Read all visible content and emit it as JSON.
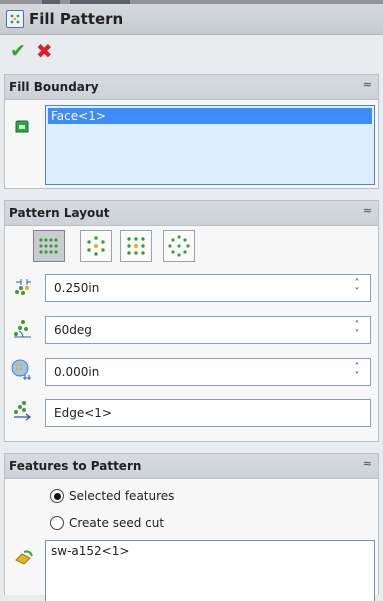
{
  "window": {
    "title": "Fill Pattern"
  },
  "actions": {
    "ok_icon": "checkmark-icon",
    "cancel_icon": "x-icon"
  },
  "fill_boundary": {
    "header": "Fill Boundary",
    "items": [
      "Face<1>"
    ]
  },
  "pattern_layout": {
    "header": "Pattern Layout",
    "layouts": [
      "perforation",
      "circular",
      "square",
      "polygon"
    ],
    "active_layout": "perforation",
    "instance_spacing": "0.250in",
    "stagger_angle": "60deg",
    "margins": "0.000in",
    "pattern_direction": "Edge<1>"
  },
  "features_to_pattern": {
    "header": "Features to Pattern",
    "options": [
      "Selected features",
      "Create seed cut"
    ],
    "selected_option": "Selected features",
    "features": [
      "sw-a152<1>"
    ]
  },
  "colors": {
    "selection_blue": "#3c8cff",
    "ok_green": "#38a32e",
    "cancel_red": "#d8232a"
  }
}
